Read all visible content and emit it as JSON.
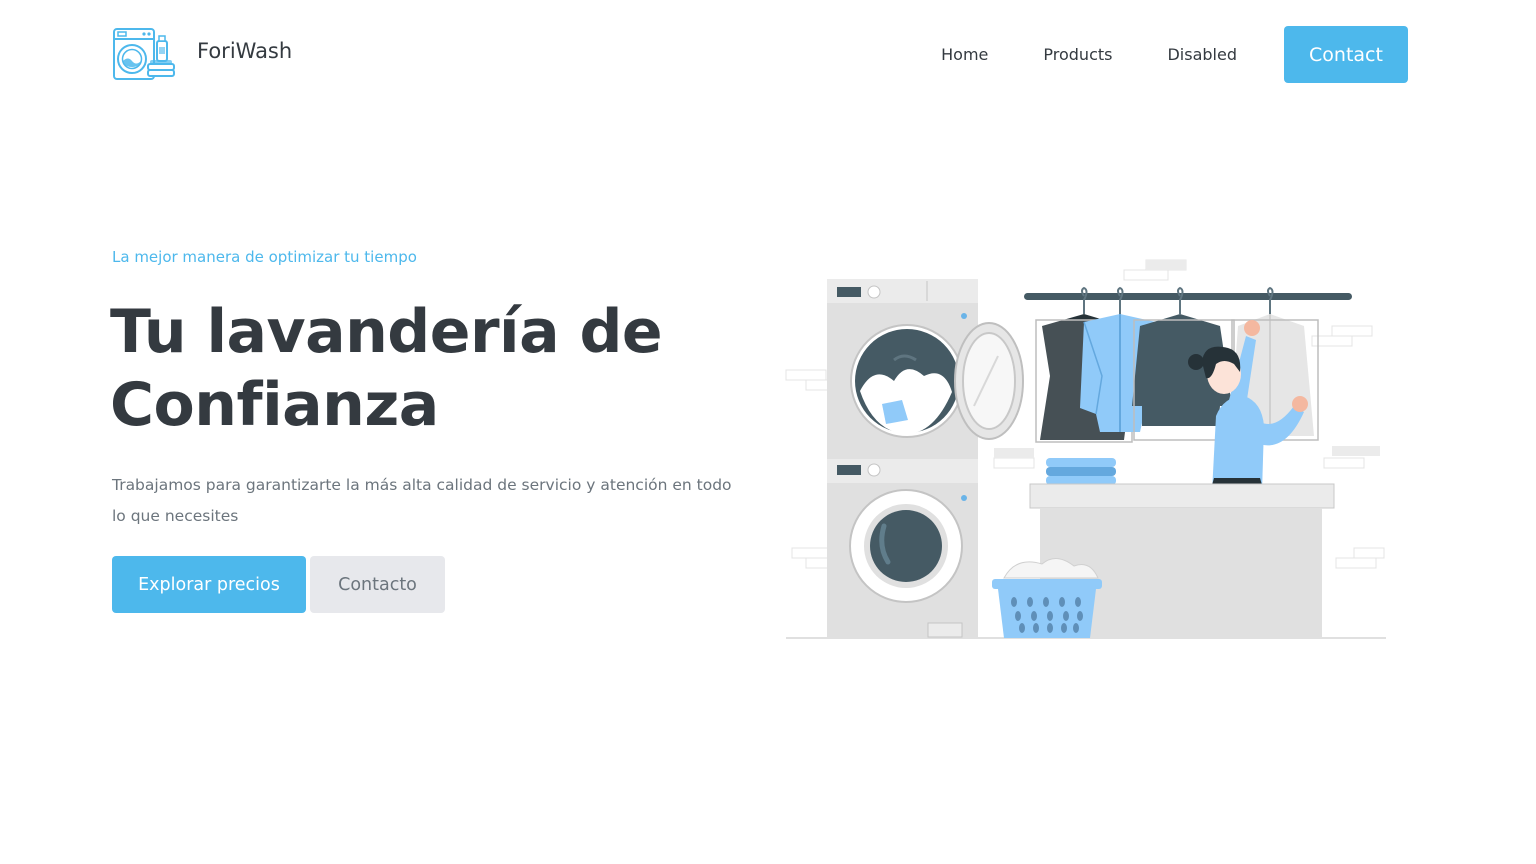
{
  "brand": {
    "name": "ForiWash",
    "logo_icon": "washing-machine-logo-icon"
  },
  "nav": {
    "items": [
      {
        "label": "Home"
      },
      {
        "label": "Products"
      },
      {
        "label": "Disabled"
      }
    ],
    "contact_label": "Contact"
  },
  "hero": {
    "eyebrow": "La mejor manera de optimizar tu tiempo",
    "title_line1": "Tu lavandería de",
    "title_line2": "Confianza",
    "description": "Trabajamos para garantizarte la más alta calidad de servicio y atención en todo lo que necesites",
    "primary_button": "Explorar precios",
    "secondary_button": "Contacto"
  },
  "colors": {
    "accent": "#4db8ec",
    "heading": "#343a40",
    "muted": "#6c757d",
    "secondary_button_bg": "#e7e8ec"
  }
}
